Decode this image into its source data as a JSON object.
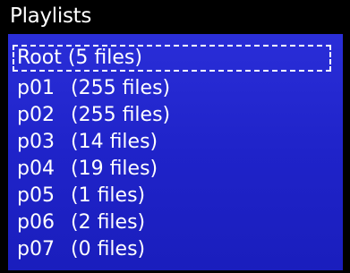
{
  "title": "Playlists",
  "list": {
    "selected_index": 0,
    "items": [
      {
        "name": "Root",
        "count": "(5 files)"
      },
      {
        "name": "p01",
        "count": "(255 files)"
      },
      {
        "name": "p02",
        "count": "(255 files)"
      },
      {
        "name": "p03",
        "count": "(14 files)"
      },
      {
        "name": "p04",
        "count": "(19 files)"
      },
      {
        "name": "p05",
        "count": "(1 files)"
      },
      {
        "name": "p06",
        "count": "(2 files)"
      },
      {
        "name": "p07",
        "count": "(0 files)"
      }
    ]
  },
  "colors": {
    "background": "#000000",
    "panel": "#2326cf",
    "text": "#ffffff",
    "selection_border": "#ffffff"
  }
}
